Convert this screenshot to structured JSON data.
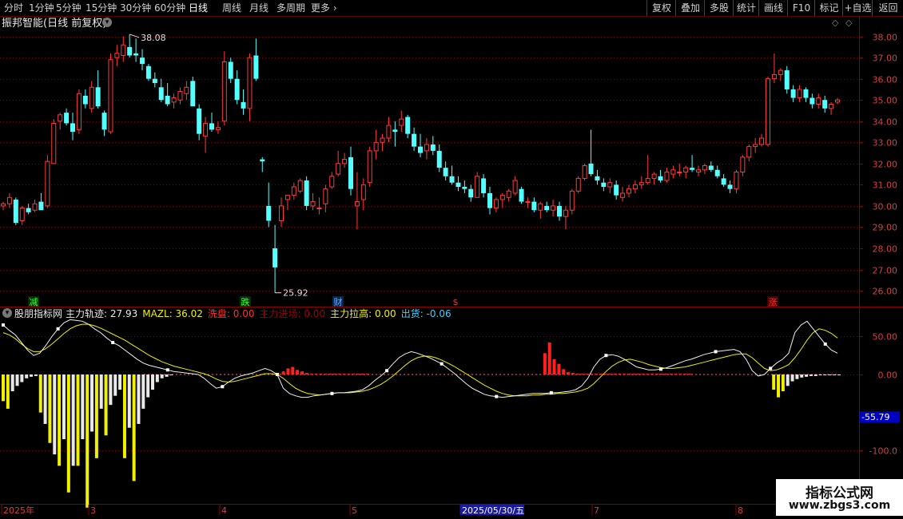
{
  "toolbar": {
    "periods": [
      "分时",
      "1分钟",
      "5分钟",
      "15分钟",
      "30分钟",
      "60分钟",
      "日线",
      "周线",
      "月线",
      "多周期",
      "更多"
    ],
    "active_period": "日线",
    "right_buttons": [
      "复权",
      "叠加",
      "多股",
      "统计",
      "画线",
      "F10",
      "标记",
      "+自选",
      "返回"
    ]
  },
  "chart_title": "振邦智能(日线 前复权)",
  "price_axis": {
    "ticks": [
      "38.00",
      "37.00",
      "36.00",
      "35.00",
      "34.00",
      "33.00",
      "32.00",
      "31.00",
      "30.00",
      "29.00",
      "28.00",
      "27.00",
      "26.00"
    ]
  },
  "annotations": {
    "high": "38.08",
    "low": "25.92"
  },
  "event_markers": [
    {
      "label": "减",
      "color": "#3cff3c"
    },
    {
      "label": "跌",
      "color": "#3cff3c"
    },
    {
      "label": "财",
      "color": "#6fa8ff"
    },
    {
      "label": "$",
      "color": "#ff3030"
    },
    {
      "label": "涨",
      "color": "#ff3030"
    }
  ],
  "indicator": {
    "name": "股朋指标网",
    "legend": [
      {
        "label": "主力轨迹:",
        "value": "27.93",
        "color": "#e8e8e8"
      },
      {
        "label": "MAZL:",
        "value": "36.02",
        "color": "#f0f000"
      },
      {
        "label": "洗盘:",
        "value": "0.00",
        "color": "#ff3030"
      },
      {
        "label": "主力进场:",
        "value": "0.00",
        "color": "#a00000"
      },
      {
        "label": "主力拉高:",
        "value": "0.00",
        "color": "#f0f000"
      },
      {
        "label": "出货:",
        "value": "-0.06",
        "color": "#40d0ff"
      }
    ],
    "axis_ticks": [
      "50.00",
      "0.00",
      "-100.0"
    ],
    "current_value": "-55.79"
  },
  "date_axis": {
    "labels": [
      "2025年",
      "3",
      "4",
      "5",
      "2025/05/30/五",
      "7",
      "8"
    ]
  },
  "watermark": {
    "title": "指标公式网",
    "url": "www.zbgs3.com"
  },
  "chart_data": {
    "type": "candlestick",
    "price_range": [
      25.7,
      38.4
    ],
    "candles": [
      [
        30.0,
        30.2,
        29.8,
        30.1
      ],
      [
        30.1,
        30.6,
        29.9,
        30.4
      ],
      [
        30.3,
        30.4,
        29.1,
        29.2
      ],
      [
        29.3,
        30.0,
        29.1,
        29.9
      ],
      [
        29.9,
        30.1,
        29.6,
        29.7
      ],
      [
        29.8,
        30.3,
        29.7,
        30.1
      ],
      [
        30.2,
        30.6,
        29.8,
        29.8
      ],
      [
        30.0,
        32.4,
        29.9,
        32.1
      ],
      [
        32.0,
        34.1,
        32.0,
        33.9
      ],
      [
        34.0,
        34.4,
        33.6,
        34.3
      ],
      [
        34.4,
        34.6,
        33.8,
        33.9
      ],
      [
        33.9,
        34.4,
        33.1,
        33.5
      ],
      [
        33.6,
        35.5,
        33.4,
        35.3
      ],
      [
        35.2,
        35.5,
        34.6,
        34.8
      ],
      [
        34.6,
        35.9,
        34.4,
        35.6
      ],
      [
        35.6,
        36.4,
        34.6,
        34.7
      ],
      [
        34.4,
        34.5,
        33.3,
        33.6
      ],
      [
        33.5,
        37.2,
        33.4,
        36.9
      ],
      [
        37.0,
        37.6,
        36.6,
        37.2
      ],
      [
        37.1,
        38.0,
        36.8,
        37.6
      ],
      [
        37.5,
        38.1,
        37.0,
        37.1
      ],
      [
        37.2,
        37.9,
        36.8,
        37.1
      ],
      [
        37.0,
        37.4,
        36.4,
        36.7
      ],
      [
        36.6,
        36.7,
        35.9,
        36.0
      ],
      [
        36.0,
        36.3,
        35.6,
        35.8
      ],
      [
        35.6,
        36.0,
        34.9,
        35.0
      ],
      [
        35.2,
        35.8,
        34.7,
        34.8
      ],
      [
        34.9,
        35.3,
        34.6,
        35.1
      ],
      [
        35.0,
        35.6,
        34.8,
        35.4
      ],
      [
        35.3,
        35.9,
        35.0,
        35.6
      ],
      [
        35.9,
        36.1,
        34.8,
        34.7
      ],
      [
        34.6,
        34.8,
        33.1,
        33.4
      ],
      [
        33.3,
        34.2,
        32.5,
        33.9
      ],
      [
        33.9,
        34.4,
        33.5,
        33.6
      ],
      [
        33.6,
        34.0,
        33.4,
        33.7
      ],
      [
        34.0,
        37.3,
        33.8,
        36.8
      ],
      [
        36.8,
        37.0,
        35.8,
        36.0
      ],
      [
        36.0,
        36.4,
        34.8,
        35.0
      ],
      [
        34.9,
        35.5,
        34.3,
        34.6
      ],
      [
        34.6,
        37.2,
        34.0,
        37.0
      ],
      [
        37.1,
        37.9,
        35.9,
        36.0
      ],
      [
        32.2,
        32.3,
        31.6,
        32.1
      ],
      [
        30.0,
        31.1,
        29.0,
        29.3
      ],
      [
        28.0,
        29.1,
        25.9,
        27.1
      ],
      [
        29.3,
        30.4,
        29.0,
        30.0
      ],
      [
        30.3,
        30.5,
        29.8,
        30.5
      ],
      [
        30.5,
        31.1,
        30.3,
        30.9
      ],
      [
        30.7,
        31.3,
        30.6,
        31.2
      ],
      [
        31.2,
        31.4,
        29.8,
        30.0
      ],
      [
        30.0,
        30.6,
        29.8,
        30.2
      ],
      [
        29.9,
        30.4,
        29.6,
        29.9
      ],
      [
        30.1,
        31.0,
        29.7,
        30.8
      ],
      [
        30.9,
        31.6,
        30.8,
        31.4
      ],
      [
        31.5,
        32.6,
        31.4,
        32.0
      ],
      [
        32.0,
        32.5,
        31.8,
        32.2
      ],
      [
        32.3,
        32.8,
        30.5,
        30.8
      ],
      [
        30.0,
        31.6,
        28.9,
        30.2
      ],
      [
        30.3,
        31.3,
        29.8,
        31.0
      ],
      [
        31.1,
        32.8,
        30.9,
        32.6
      ],
      [
        32.6,
        33.6,
        32.2,
        33.0
      ],
      [
        33.0,
        33.4,
        32.6,
        33.2
      ],
      [
        33.2,
        34.2,
        33.0,
        33.8
      ],
      [
        33.6,
        34.0,
        32.8,
        33.5
      ],
      [
        33.8,
        34.5,
        33.5,
        34.1
      ],
      [
        34.2,
        34.3,
        33.2,
        33.4
      ],
      [
        33.4,
        33.7,
        32.6,
        32.8
      ],
      [
        32.8,
        33.4,
        32.3,
        32.5
      ],
      [
        32.6,
        33.2,
        32.2,
        32.9
      ],
      [
        32.9,
        33.3,
        32.4,
        32.6
      ],
      [
        32.6,
        32.9,
        31.6,
        31.8
      ],
      [
        31.8,
        32.1,
        31.2,
        31.4
      ],
      [
        31.4,
        31.9,
        31.0,
        31.1
      ],
      [
        31.1,
        31.4,
        30.7,
        30.9
      ],
      [
        30.9,
        31.2,
        30.6,
        30.8
      ],
      [
        30.8,
        31.0,
        30.2,
        30.4
      ],
      [
        30.4,
        31.6,
        30.4,
        31.4
      ],
      [
        31.3,
        31.5,
        30.4,
        30.6
      ],
      [
        30.6,
        30.9,
        29.6,
        29.9
      ],
      [
        29.9,
        30.4,
        29.7,
        30.3
      ],
      [
        30.3,
        30.6,
        29.9,
        30.5
      ],
      [
        30.4,
        30.8,
        30.2,
        30.7
      ],
      [
        30.6,
        31.4,
        30.5,
        31.2
      ],
      [
        30.8,
        30.9,
        30.1,
        30.2
      ],
      [
        30.2,
        30.4,
        29.9,
        30.2
      ],
      [
        30.2,
        30.4,
        29.7,
        29.8
      ],
      [
        29.8,
        30.2,
        29.4,
        30.1
      ],
      [
        30.0,
        30.2,
        29.7,
        29.8
      ],
      [
        29.8,
        30.3,
        29.5,
        30.0
      ],
      [
        30.0,
        30.2,
        29.3,
        29.5
      ],
      [
        29.5,
        30.0,
        28.9,
        29.8
      ],
      [
        29.8,
        30.8,
        29.6,
        30.7
      ],
      [
        30.7,
        31.4,
        30.6,
        31.3
      ],
      [
        31.3,
        32.0,
        31.2,
        31.9
      ],
      [
        32.0,
        33.6,
        31.4,
        31.5
      ],
      [
        31.4,
        31.7,
        31.0,
        31.2
      ],
      [
        31.1,
        31.3,
        30.7,
        30.9
      ],
      [
        30.9,
        31.3,
        30.6,
        31.1
      ],
      [
        31.0,
        31.2,
        30.3,
        30.5
      ],
      [
        30.4,
        30.9,
        30.2,
        30.6
      ],
      [
        30.6,
        31.0,
        30.4,
        30.8
      ],
      [
        30.8,
        31.2,
        30.6,
        31.0
      ],
      [
        31.0,
        31.4,
        30.8,
        31.1
      ],
      [
        31.1,
        32.4,
        31.0,
        31.3
      ],
      [
        31.3,
        31.6,
        31.0,
        31.5
      ],
      [
        31.4,
        31.7,
        31.1,
        31.2
      ],
      [
        31.2,
        31.8,
        31.1,
        31.6
      ],
      [
        31.5,
        31.9,
        31.3,
        31.7
      ],
      [
        31.6,
        32.0,
        31.4,
        31.6
      ],
      [
        31.6,
        31.9,
        31.3,
        31.8
      ],
      [
        31.8,
        32.4,
        31.6,
        31.7
      ],
      [
        31.6,
        31.9,
        31.4,
        31.7
      ],
      [
        31.7,
        32.0,
        31.5,
        31.9
      ],
      [
        31.9,
        32.1,
        31.6,
        31.7
      ],
      [
        31.7,
        31.9,
        31.3,
        31.4
      ],
      [
        31.3,
        31.5,
        30.9,
        31.0
      ],
      [
        31.0,
        31.2,
        30.6,
        30.8
      ],
      [
        30.8,
        31.7,
        30.6,
        31.6
      ],
      [
        31.6,
        32.4,
        31.4,
        32.3
      ],
      [
        32.3,
        32.9,
        32.1,
        32.8
      ],
      [
        32.8,
        33.2,
        32.5,
        32.9
      ],
      [
        32.9,
        33.4,
        32.8,
        33.2
      ],
      [
        32.9,
        36.1,
        32.8,
        36.0
      ],
      [
        36.0,
        37.2,
        35.8,
        36.2
      ],
      [
        36.2,
        36.5,
        35.9,
        36.4
      ],
      [
        36.4,
        36.6,
        35.3,
        35.5
      ],
      [
        35.5,
        35.7,
        34.9,
        35.1
      ],
      [
        35.1,
        35.7,
        34.9,
        35.5
      ],
      [
        35.5,
        35.6,
        34.9,
        35.1
      ],
      [
        35.1,
        35.3,
        34.6,
        34.8
      ],
      [
        34.8,
        35.3,
        34.6,
        35.1
      ],
      [
        35.0,
        35.2,
        34.4,
        34.6
      ],
      [
        34.6,
        34.9,
        34.3,
        34.8
      ],
      [
        34.9,
        35.1,
        34.8,
        35.0
      ]
    ],
    "indicator_range": [
      -170,
      85
    ],
    "trajectory_line": [
      65,
      58,
      52,
      42,
      32,
      25,
      28,
      38,
      50,
      60,
      68,
      72,
      71,
      70,
      66,
      60,
      55,
      48,
      42,
      38,
      32,
      26,
      20,
      15,
      12,
      10,
      8,
      6,
      4,
      3,
      2,
      1,
      0,
      -5,
      -12,
      -18,
      -16,
      -10,
      -5,
      -2,
      0,
      2,
      5,
      8,
      5,
      0,
      -18,
      -25,
      -28,
      -30,
      -30,
      -28,
      -27,
      -26,
      -25,
      -24,
      -24,
      -23,
      -22,
      -20,
      -15,
      -8,
      -2,
      5,
      14,
      22,
      27,
      30,
      28,
      25,
      22,
      18,
      14,
      8,
      2,
      -5,
      -12,
      -18,
      -22,
      -26,
      -28,
      -29,
      -30,
      -29,
      -28,
      -27,
      -26,
      -25,
      -25,
      -25,
      -24,
      -24,
      -23,
      -22,
      -20,
      -15,
      -5,
      10,
      20,
      25,
      26,
      24,
      20,
      15,
      10,
      8,
      6,
      6,
      7,
      9,
      12,
      15,
      18,
      20,
      23,
      26,
      28,
      30,
      31,
      32,
      33,
      30,
      20,
      5,
      -2,
      0,
      8,
      15,
      20,
      28,
      55,
      65,
      70,
      60,
      50,
      40,
      32,
      28
    ],
    "mazl_line": [
      55,
      52,
      47,
      40,
      34,
      30,
      30,
      34,
      40,
      47,
      54,
      60,
      64,
      66,
      66,
      64,
      61,
      57,
      53,
      49,
      45,
      40,
      35,
      30,
      25,
      21,
      17,
      14,
      11,
      9,
      7,
      5,
      3,
      1,
      -2,
      -6,
      -9,
      -10,
      -9,
      -7,
      -5,
      -3,
      -1,
      1,
      1,
      0,
      -5,
      -12,
      -18,
      -22,
      -25,
      -26,
      -27,
      -26,
      -25,
      -24,
      -24,
      -24,
      -23,
      -22,
      -20,
      -17,
      -13,
      -8,
      -2,
      5,
      12,
      18,
      22,
      24,
      24,
      22,
      19,
      15,
      11,
      6,
      1,
      -4,
      -9,
      -14,
      -18,
      -22,
      -25,
      -27,
      -28,
      -28,
      -28,
      -27,
      -27,
      -26,
      -26,
      -25,
      -25,
      -24,
      -23,
      -21,
      -18,
      -12,
      -4,
      4,
      11,
      16,
      19,
      20,
      18,
      16,
      13,
      11,
      9,
      8,
      8,
      9,
      10,
      12,
      14,
      16,
      18,
      20,
      22,
      24,
      26,
      27,
      27,
      22,
      15,
      8,
      5,
      6,
      9,
      13,
      22,
      33,
      45,
      55,
      60,
      58,
      54,
      48
    ],
    "bars_red": [
      [
        59,
        1
      ],
      [
        60,
        4
      ],
      [
        61,
        8
      ],
      [
        62,
        10
      ],
      [
        63,
        6
      ],
      [
        64,
        4
      ],
      [
        65,
        2
      ],
      [
        66,
        1
      ],
      [
        67,
        1
      ],
      [
        68,
        1
      ],
      [
        69,
        1
      ],
      [
        70,
        1
      ],
      [
        71,
        1
      ],
      [
        72,
        1
      ],
      [
        73,
        1
      ],
      [
        74,
        1
      ],
      [
        75,
        1
      ],
      [
        76,
        1
      ],
      [
        77,
        1
      ],
      [
        78,
        1
      ],
      [
        116,
        28
      ],
      [
        117,
        42
      ],
      [
        118,
        20
      ],
      [
        119,
        14
      ],
      [
        120,
        7
      ],
      [
        121,
        3
      ],
      [
        122,
        2
      ],
      [
        123,
        1
      ],
      [
        124,
        1
      ],
      [
        125,
        1
      ],
      [
        126,
        1
      ],
      [
        127,
        1
      ],
      [
        128,
        1
      ],
      [
        129,
        1
      ],
      [
        130,
        1
      ],
      [
        131,
        1
      ],
      [
        132,
        1
      ],
      [
        133,
        1
      ],
      [
        134,
        1
      ],
      [
        135,
        1
      ],
      [
        136,
        1
      ],
      [
        137,
        1
      ],
      [
        138,
        1
      ],
      [
        139,
        1
      ],
      [
        140,
        1
      ],
      [
        141,
        1
      ],
      [
        142,
        1
      ],
      [
        143,
        1
      ],
      [
        144,
        1
      ],
      [
        145,
        1
      ],
      [
        146,
        1
      ],
      [
        147,
        1
      ]
    ],
    "bars_yellow": [
      [
        0,
        -35
      ],
      [
        1,
        -45
      ],
      [
        8,
        -50
      ],
      [
        10,
        -90
      ],
      [
        12,
        -120
      ],
      [
        14,
        -155
      ],
      [
        16,
        -120
      ],
      [
        18,
        -175
      ],
      [
        20,
        -110
      ],
      [
        22,
        -80
      ],
      [
        26,
        -110
      ],
      [
        28,
        -140
      ],
      [
        165,
        -20
      ],
      [
        166,
        -30
      ],
      [
        167,
        -22
      ]
    ],
    "bars_white": [
      [
        2,
        -22
      ],
      [
        3,
        -15
      ],
      [
        4,
        -10
      ],
      [
        5,
        -5
      ],
      [
        6,
        -3
      ],
      [
        7,
        -2
      ],
      [
        9,
        -65
      ],
      [
        11,
        -105
      ],
      [
        13,
        -85
      ],
      [
        15,
        -120
      ],
      [
        17,
        -85
      ],
      [
        19,
        -75
      ],
      [
        21,
        -45
      ],
      [
        23,
        -40
      ],
      [
        24,
        -28
      ],
      [
        25,
        -20
      ],
      [
        27,
        -70
      ],
      [
        29,
        -65
      ],
      [
        30,
        -45
      ],
      [
        31,
        -30
      ],
      [
        32,
        -20
      ],
      [
        33,
        -10
      ],
      [
        34,
        -5
      ],
      [
        35,
        -3
      ],
      [
        36,
        -1
      ],
      [
        168,
        -15
      ],
      [
        169,
        -9
      ],
      [
        170,
        -6
      ],
      [
        171,
        -4
      ],
      [
        172,
        -3
      ],
      [
        173,
        -2
      ],
      [
        174,
        -2
      ],
      [
        175,
        -1
      ],
      [
        176,
        -1
      ],
      [
        177,
        -1
      ],
      [
        178,
        -1
      ],
      [
        179,
        -1
      ]
    ]
  }
}
